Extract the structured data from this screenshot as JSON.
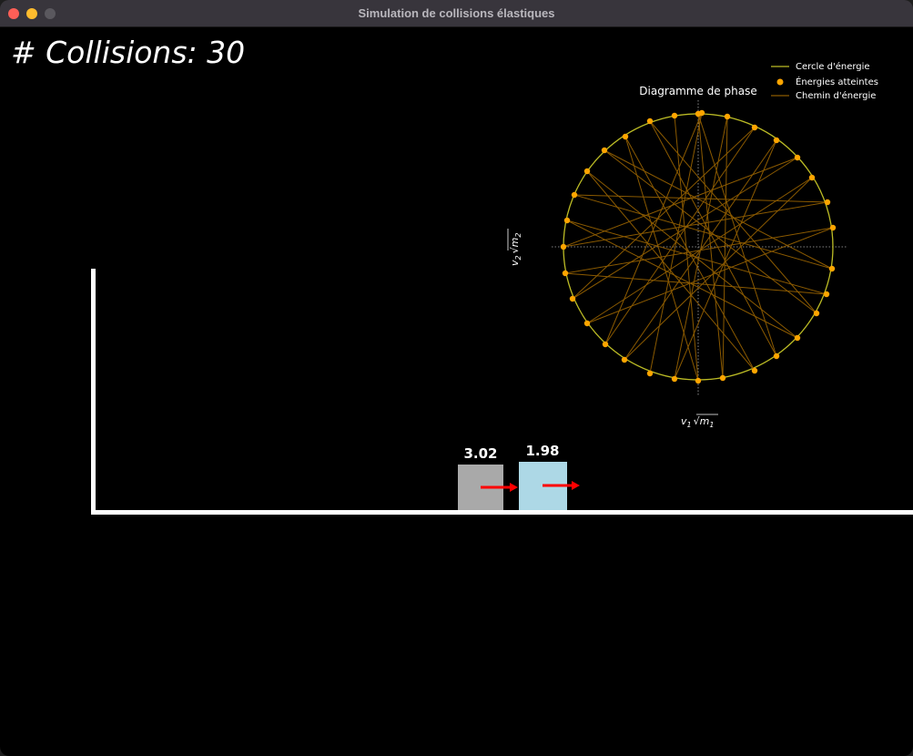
{
  "window": {
    "title": "Simulation de collisions élastiques"
  },
  "simulation": {
    "collisions_label": "# Collisions: 30",
    "blocks": [
      {
        "mass_label": "3.02",
        "color": "#a9a9a9"
      },
      {
        "mass_label": "1.98",
        "color": "#add8e6"
      }
    ],
    "floor_color": "#ffffff",
    "velocity_arrow_color": "#ff0000"
  },
  "phase_diagram": {
    "title": "Diagramme de phase",
    "xlabel_main": "v",
    "xlabel_sub": "1",
    "xlabel_mass": "m",
    "xlabel_mass_sub": "1",
    "ylabel_main": "v",
    "ylabel_sub": "2",
    "ylabel_mass": "m",
    "ylabel_mass_sub": "2",
    "legend": {
      "circle": "Cercle d'énergie",
      "points": "Énergies atteintes",
      "path": "Chemin d'énergie"
    },
    "colors": {
      "circle": "#bcbc25",
      "points": "#ffa500",
      "path": "#8b5a00"
    }
  }
}
